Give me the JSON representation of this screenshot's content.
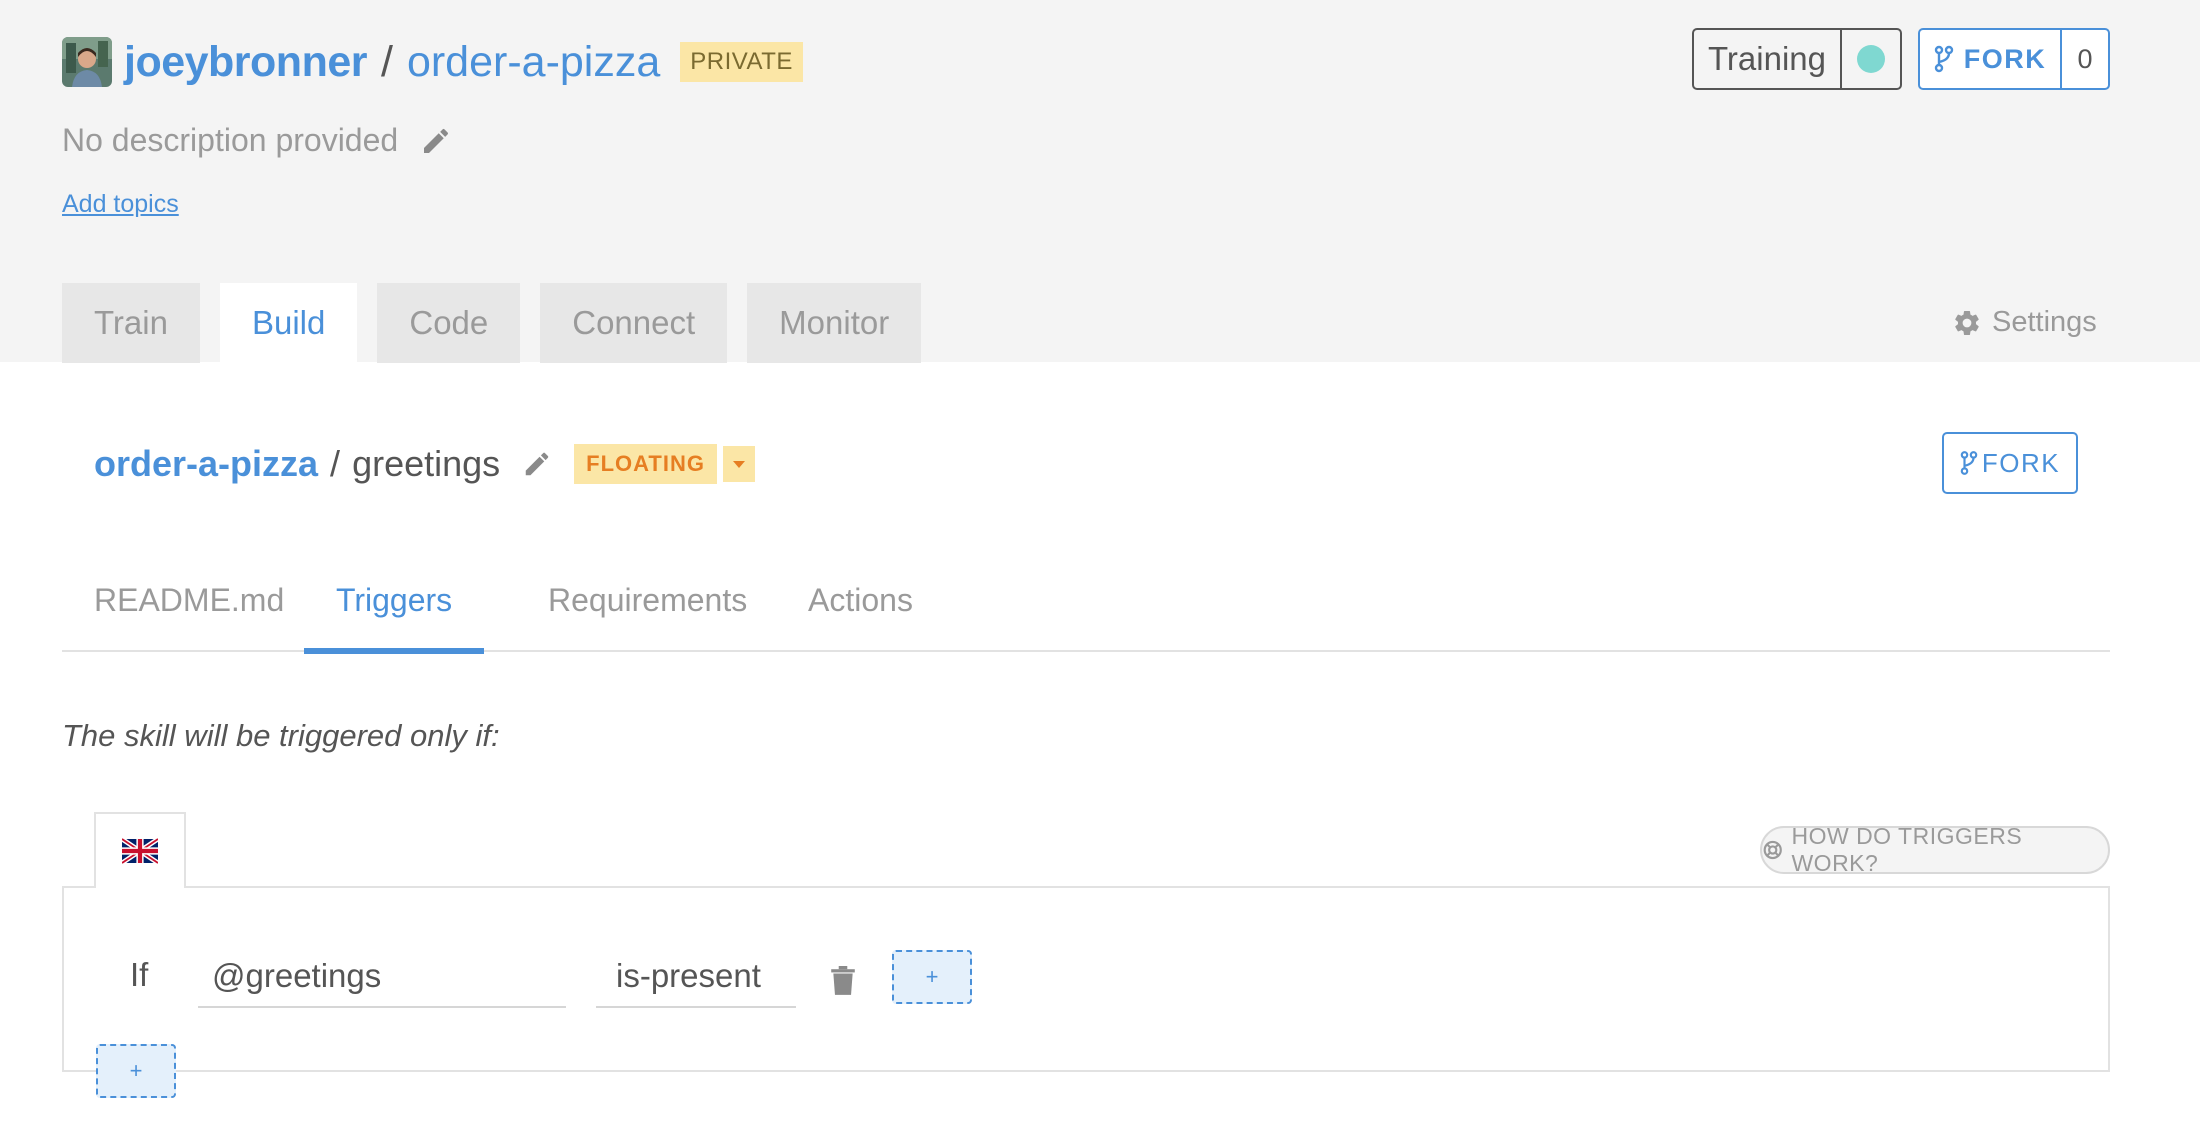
{
  "repo": {
    "owner": "joeybronner",
    "separator": "/",
    "name": "order-a-pizza",
    "visibility_badge": "PRIVATE",
    "description": "No description provided",
    "add_topics_label": "Add topics"
  },
  "actions": {
    "training_label": "Training",
    "training_status_color": "#7fd8d1",
    "fork_label": "FORK",
    "fork_count": "0"
  },
  "tabs": [
    {
      "label": "Train",
      "active": false
    },
    {
      "label": "Build",
      "active": true
    },
    {
      "label": "Code",
      "active": false
    },
    {
      "label": "Connect",
      "active": false
    },
    {
      "label": "Monitor",
      "active": false
    }
  ],
  "settings_label": "Settings",
  "skill": {
    "repo": "order-a-pizza",
    "separator": "/",
    "name": "greetings",
    "status_badge": "FLOATING",
    "fork_label": "FORK"
  },
  "sub_tabs": [
    {
      "label": "README.md",
      "active": false
    },
    {
      "label": "Triggers",
      "active": true
    },
    {
      "label": "Requirements",
      "active": false
    },
    {
      "label": "Actions",
      "active": false
    }
  ],
  "triggers": {
    "note": "The skill will be triggered only if:",
    "language_icon": "uk-flag-icon",
    "help_label": "HOW DO TRIGGERS WORK?",
    "condition": {
      "if_label": "If",
      "entity": "@greetings",
      "operator": "is-present"
    },
    "add_condition_label": "+",
    "add_trigger_label": "+"
  },
  "colors": {
    "accent": "#4a90d9",
    "header_bg": "#f4f4f4",
    "badge_bg": "#fbe6a6",
    "floating_text": "#e67e22"
  }
}
